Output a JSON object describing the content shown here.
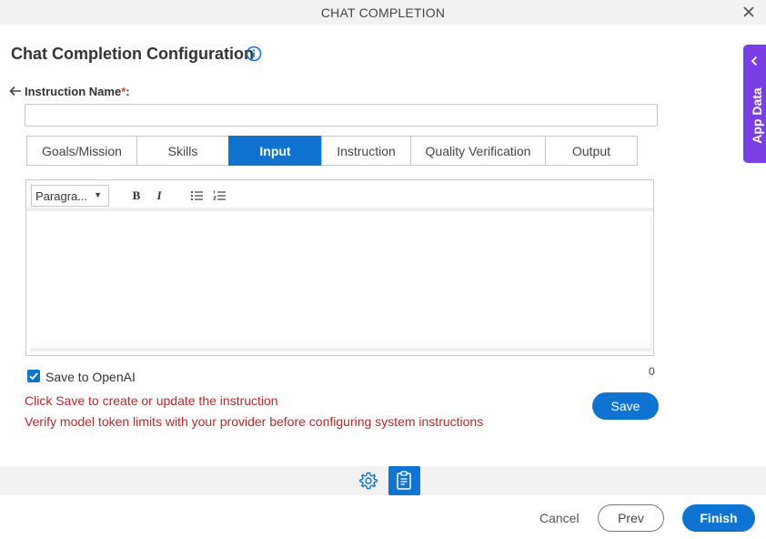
{
  "window": {
    "title": "CHAT COMPLETION",
    "close_icon": "close-icon"
  },
  "page": {
    "heading": "Chat Completion Configuration",
    "info_icon": "info-icon"
  },
  "instruction": {
    "label": "Instruction Name",
    "required_mark": "*",
    "label_suffix": ":",
    "value": ""
  },
  "tabs": [
    {
      "label": "Goals/Mission",
      "active": false
    },
    {
      "label": "Skills",
      "active": false
    },
    {
      "label": "Input",
      "active": true
    },
    {
      "label": "Instruction",
      "active": false
    },
    {
      "label": "Quality Verification",
      "active": false
    },
    {
      "label": "Output",
      "active": false
    }
  ],
  "editor": {
    "format_value": "Paragra...",
    "toolbar": [
      "bold",
      "italic",
      "bulleted-list",
      "numbered-list"
    ],
    "bold_label": "B",
    "italic_label": "I",
    "content": "",
    "char_count": "0"
  },
  "save_to_openai": {
    "label": "Save to OpenAI",
    "checked": true
  },
  "messages": {
    "line1": "Click Save to create or update the instruction",
    "line2": "Verify model token limits with your provider before configuring system instructions"
  },
  "save_label": "Save",
  "app_data": {
    "label": "App Data"
  },
  "footer": {
    "cancel_label": "Cancel",
    "prev_label": "Prev",
    "finish_label": "Finish"
  },
  "colors": {
    "accent": "#0f73d2",
    "app_data_bg": "#7a3fe4",
    "warning_text": "#b52a2a",
    "required_mark": "#e03e2d"
  }
}
